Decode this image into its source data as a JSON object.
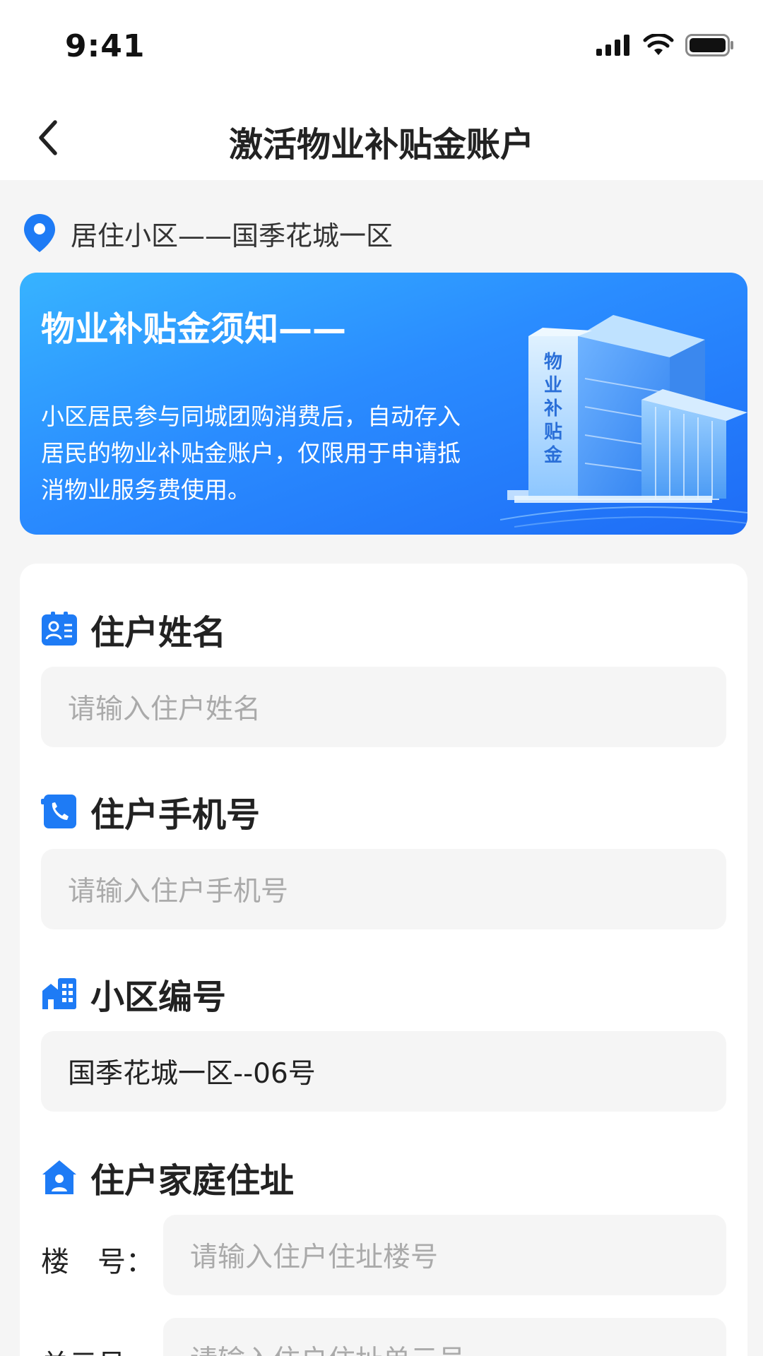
{
  "status_bar": {
    "time": "9:41",
    "icons": [
      "signal-icon",
      "wifi-icon",
      "battery-icon"
    ]
  },
  "nav": {
    "back_icon": "chevron-left-icon",
    "title": "激活物业补贴金账户"
  },
  "location": {
    "icon": "location-pin-icon",
    "text": "居住小区——国季花城一区"
  },
  "banner": {
    "title": "物业补贴金须知——",
    "text": "小区居民参与同城团购消费后，自动存入居民的物业补贴金账户，仅限用于申请抵消物业服务费使用。",
    "building_sign": "物业补贴金"
  },
  "form": {
    "name": {
      "icon": "id-card-icon",
      "label": "住户姓名",
      "placeholder": "请输入住户姓名"
    },
    "phone": {
      "icon": "phone-icon",
      "label": "住户手机号",
      "placeholder": "请输入住户手机号"
    },
    "community": {
      "icon": "building-icon",
      "label": "小区编号",
      "value": "国季花城一区--06号"
    },
    "address": {
      "icon": "home-icon",
      "label": "住户家庭住址",
      "building_label": "楼　号：",
      "building_placeholder": "请输入住户住址楼号",
      "unit_label": "单元号：",
      "unit_placeholder": "请输入住户住址单元号"
    }
  },
  "colors": {
    "accent": "#1e7bf5",
    "banner_start": "#37b3ff",
    "banner_end": "#1e6cf6",
    "page_bg": "#f5f5f5",
    "input_bg": "#f5f5f5"
  }
}
